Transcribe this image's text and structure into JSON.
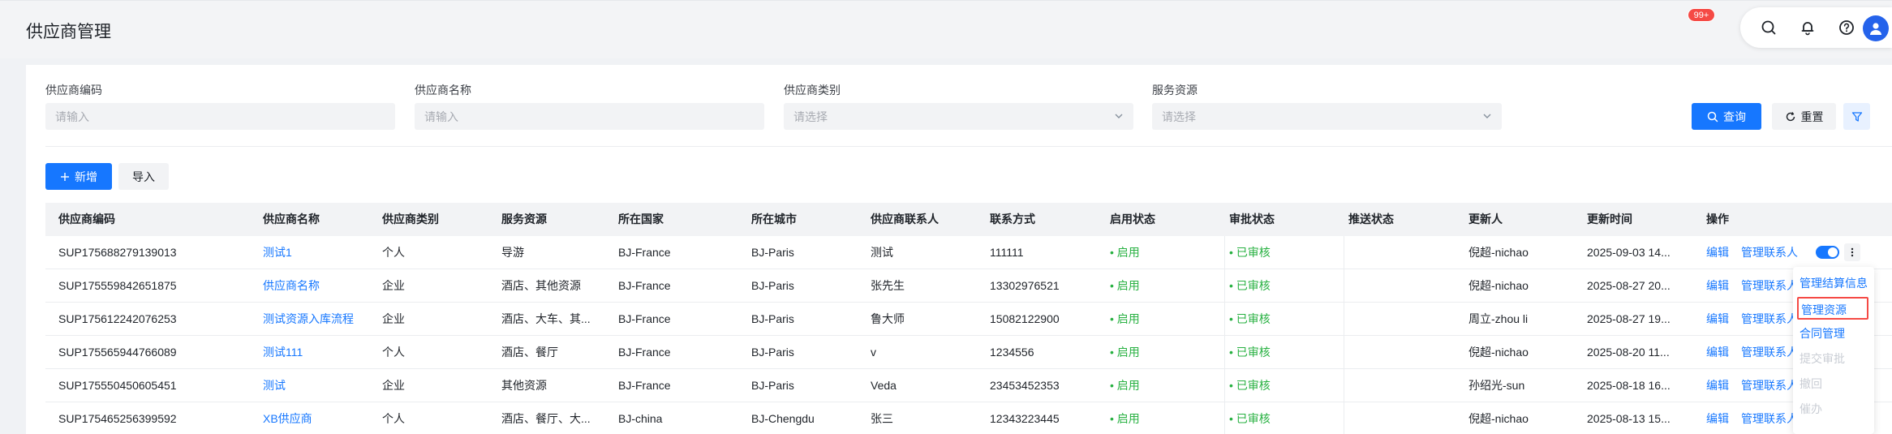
{
  "page": {
    "title": "供应商管理"
  },
  "topbar": {
    "notification_badge": "99+"
  },
  "filters": [
    {
      "label": "供应商编码",
      "placeholder": "请输入",
      "type": "input"
    },
    {
      "label": "供应商名称",
      "placeholder": "请输入",
      "type": "input"
    },
    {
      "label": "供应商类别",
      "placeholder": "请选择",
      "type": "select"
    },
    {
      "label": "服务资源",
      "placeholder": "请选择",
      "type": "select"
    }
  ],
  "actions": {
    "query": "查询",
    "reset": "重置",
    "add": "新增",
    "import": "导入"
  },
  "table": {
    "columns": [
      "供应商编码",
      "供应商名称",
      "供应商类别",
      "服务资源",
      "所在国家",
      "所在城市",
      "供应商联系人",
      "联系方式",
      "启用状态",
      "审批状态",
      "推送状态",
      "更新人",
      "更新时间",
      "操作"
    ],
    "rows": [
      {
        "code": "SUP175688279139013",
        "name": "测试1",
        "category": "个人",
        "resource": "导游",
        "country": "BJ-France",
        "city": "BJ-Paris",
        "contact": "测试",
        "phone": "111111",
        "enabled": "启用",
        "approval": "已审核",
        "push": "",
        "updater": "倪超-nichao",
        "updated": "2025-09-03 14...",
        "op_edit": "编辑",
        "op_contacts": "管理联系人"
      },
      {
        "code": "SUP175559842651875",
        "name": "供应商名称",
        "category": "企业",
        "resource": "酒店、其他资源",
        "country": "BJ-France",
        "city": "BJ-Paris",
        "contact": "张先生",
        "phone": "13302976521",
        "enabled": "启用",
        "approval": "已审核",
        "push": "",
        "updater": "倪超-nichao",
        "updated": "2025-08-27 20...",
        "op_edit": "编辑",
        "op_contacts": "管理联系人"
      },
      {
        "code": "SUP175612242076253",
        "name": "测试资源入库流程",
        "category": "企业",
        "resource": "酒店、大车、其...",
        "country": "BJ-France",
        "city": "BJ-Paris",
        "contact": "鲁大师",
        "phone": "15082122900",
        "enabled": "启用",
        "approval": "已审核",
        "push": "",
        "updater": "周立-zhou li",
        "updated": "2025-08-27 19...",
        "op_edit": "编辑",
        "op_contacts": "管理联系人"
      },
      {
        "code": "SUP175565944766089",
        "name": "测试111",
        "category": "个人",
        "resource": "酒店、餐厅",
        "country": "BJ-France",
        "city": "BJ-Paris",
        "contact": "v",
        "phone": "1234556",
        "enabled": "启用",
        "approval": "已审核",
        "push": "",
        "updater": "倪超-nichao",
        "updated": "2025-08-20 11...",
        "op_edit": "编辑",
        "op_contacts": "管理联系人"
      },
      {
        "code": "SUP175550450605451",
        "name": "测试",
        "category": "企业",
        "resource": "其他资源",
        "country": "BJ-France",
        "city": "BJ-Paris",
        "contact": "Veda",
        "phone": "23453452353",
        "enabled": "启用",
        "approval": "已审核",
        "push": "",
        "updater": "孙绍光-sun",
        "updated": "2025-08-18 16...",
        "op_edit": "编辑",
        "op_contacts": "管理联系人"
      },
      {
        "code": "SUP175465256399592",
        "name": "XB供应商",
        "category": "个人",
        "resource": "酒店、餐厅、大...",
        "country": "BJ-china",
        "city": "BJ-Chengdu",
        "contact": "张三",
        "phone": "12343223445",
        "enabled": "启用",
        "approval": "已审核",
        "push": "",
        "updater": "倪超-nichao",
        "updated": "2025-08-13 15...",
        "op_edit": "编辑",
        "op_contacts": "管理联系人"
      }
    ]
  },
  "dropdown": {
    "items": [
      {
        "label": "管理结算信息",
        "state": "enabled"
      },
      {
        "label": "管理资源",
        "state": "selected"
      },
      {
        "label": "合同管理",
        "state": "enabled"
      },
      {
        "label": "提交审批",
        "state": "disabled"
      },
      {
        "label": "撤回",
        "state": "disabled"
      },
      {
        "label": "催办",
        "state": "disabled"
      }
    ]
  },
  "colors": {
    "primary": "#1677ff",
    "success": "#28b142",
    "danger": "#f54a45"
  }
}
